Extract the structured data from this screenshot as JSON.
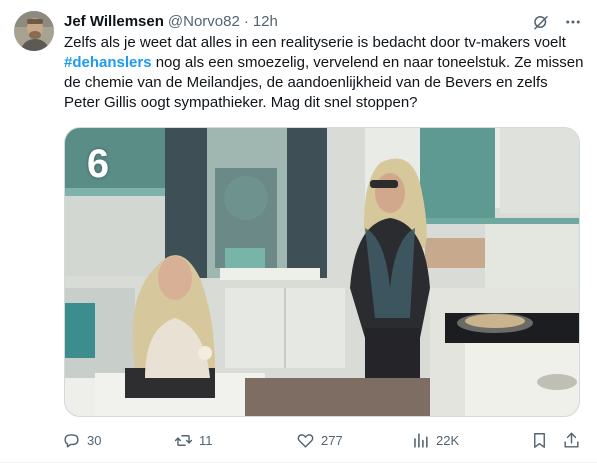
{
  "author": {
    "name": "Jef Willemsen",
    "handle": "@Norvo82",
    "separator": "·",
    "time": "12h"
  },
  "tweet": {
    "text_before": "Zelfs als je weet dat alles in een realityserie is bedacht door tv-makers voelt ",
    "hashtag": "#dehanslers",
    "text_after": " nog als een smoezelig, vervelend en naar toneelstuk. Ze missen de chemie van de Meilandjes, de aandoenlijkheid van de Bevers en zelfs Peter Gillis oogt sympathieker. Mag dit snel stoppen?"
  },
  "media": {
    "channel_logo": "6"
  },
  "actions": {
    "reply_count": "30",
    "retweet_count": "11",
    "like_count": "277",
    "views_count": "22K"
  },
  "icons": {
    "grok": "grok-icon",
    "more": "more-icon",
    "reply": "reply-icon",
    "retweet": "retweet-icon",
    "like": "heart-icon",
    "views": "views-icon",
    "bookmark": "bookmark-icon",
    "share": "share-icon"
  },
  "colors": {
    "text": "#0f1419",
    "secondary": "#536471",
    "link": "#1d9bf0"
  }
}
